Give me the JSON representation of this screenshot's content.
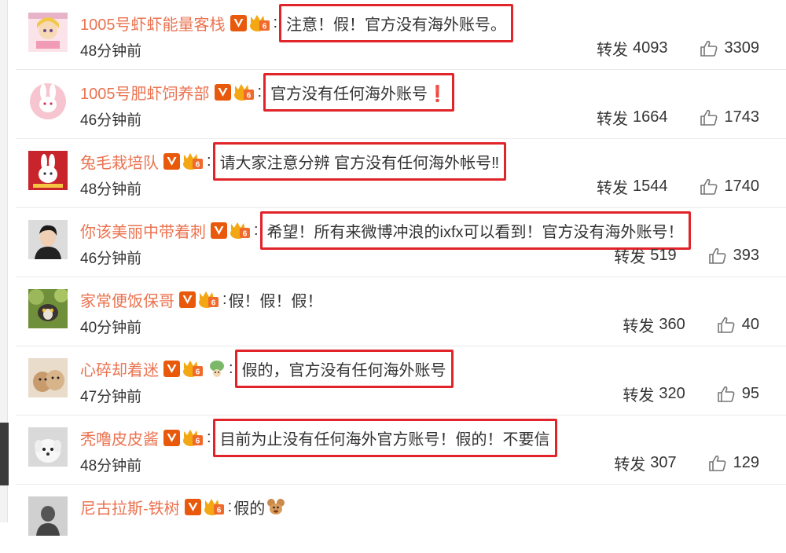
{
  "labels": {
    "repost": "转发"
  },
  "comments": [
    {
      "username": "1005号虾虾能量客栈",
      "text": "注意！假！官方没有海外账号。",
      "time": "48分钟前",
      "reposts": "4093",
      "likes": "3309"
    },
    {
      "username": "1005号肥虾饲养部",
      "text": "官方没有任何海外账号❗",
      "time": "46分钟前",
      "reposts": "1664",
      "likes": "1743"
    },
    {
      "username": "兔毛栽培队",
      "text": "请大家注意分辨 官方没有任何海外帐号‼",
      "time": "48分钟前",
      "reposts": "1544",
      "likes": "1740"
    },
    {
      "username": "你该美丽中带着刺",
      "text": "希望！所有来微博冲浪的ixfx可以看到！官方没有海外账号！",
      "time": "46分钟前",
      "reposts": "519",
      "likes": "393"
    },
    {
      "username": "家常便饭保哥",
      "text": "假！假！假！",
      "time": "40分钟前",
      "reposts": "360",
      "likes": "40"
    },
    {
      "username": "心碎却着迷",
      "text": "假的，官方没有任何海外账号",
      "time": "47分钟前",
      "reposts": "320",
      "likes": "95"
    },
    {
      "username": "秃噜皮皮酱",
      "text": "目前为止没有任何海外官方账号！假的！不要信",
      "time": "48分钟前",
      "reposts": "307",
      "likes": "129"
    },
    {
      "username": "尼古拉斯-铁树",
      "text": "假的",
      "time": "",
      "reposts": "",
      "likes": ""
    }
  ],
  "colors": {
    "username": "#eb7350",
    "highlight_box": "#e0242a",
    "badge_v": "#e8590c",
    "text": "#333333"
  },
  "icons": [
    "verified-v-icon",
    "level-crown-icon",
    "thumbs-up-icon",
    "tree-emoji-icon",
    "jerry-mouse-emoji-icon"
  ]
}
